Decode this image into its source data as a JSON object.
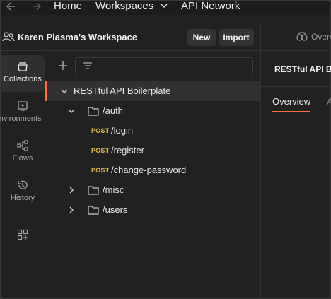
{
  "topbar": {
    "back_icon": "arrow-left-icon",
    "forward_icon": "arrow-right-icon",
    "home": "Home",
    "workspaces": "Workspaces",
    "api_network": "API Network"
  },
  "workspace": {
    "name": "Karen Plasma's Workspace",
    "new_label": "New",
    "import_label": "Import"
  },
  "right_header": {
    "tab_label": "Overv"
  },
  "rail": {
    "items": [
      {
        "label": "Collections",
        "icon": "collections-icon",
        "active": true
      },
      {
        "label": "Environments",
        "icon": "environments-icon",
        "active": false
      },
      {
        "label": "Flows",
        "icon": "flows-icon",
        "active": false
      },
      {
        "label": "History",
        "icon": "history-icon",
        "active": false
      },
      {
        "label": "",
        "icon": "add-workbench-icon",
        "active": false
      }
    ]
  },
  "tree": {
    "collection": "RESTful API Boilerplate",
    "folders": [
      {
        "name": "/auth",
        "expanded": true
      },
      {
        "name": "/misc",
        "expanded": false
      },
      {
        "name": "/users",
        "expanded": false
      }
    ],
    "requests": [
      {
        "method": "POST",
        "name": "/login"
      },
      {
        "method": "POST",
        "name": "/register"
      },
      {
        "method": "POST",
        "name": "/change-password"
      }
    ]
  },
  "main": {
    "title": "RESTful API B",
    "tabs": [
      {
        "label": "Overview",
        "active": true
      },
      {
        "label": "A",
        "active": false
      }
    ]
  },
  "colors": {
    "accent": "#ff6c37",
    "post_method": "#e0b94a",
    "background": "#212121"
  }
}
